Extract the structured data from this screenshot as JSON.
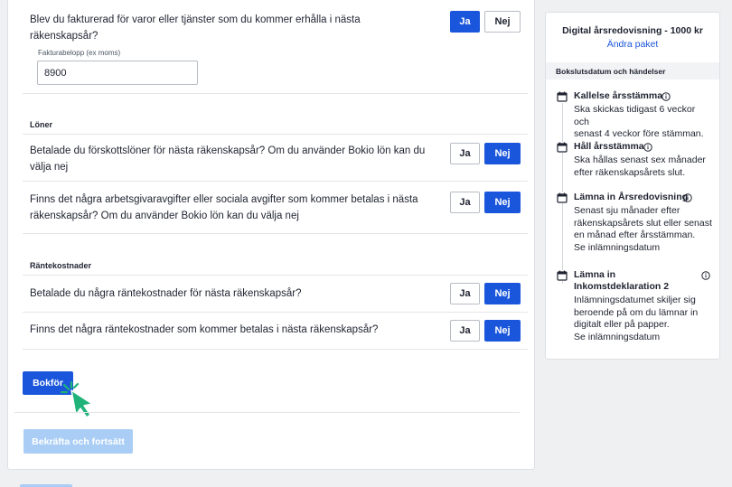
{
  "questions": {
    "invoiced": {
      "text_line1": "Blev du fakturerad för varor eller tjänster som du kommer erhålla i nästa",
      "text_line2": "räkenskapsår?",
      "field_label": "Fakturabelopp (ex moms)",
      "field_value": "8900",
      "yes": "Ja",
      "no": "Nej"
    }
  },
  "salaries": {
    "section_title": "Löner",
    "q1_line1": "Betalade du förskottslöner för nästa räkenskapsår? Om du använder Bokio lön kan du",
    "q1_line2": "välja nej",
    "q2_line1": "Finns det några arbetsgivaravgifter eller sociala avgifter som kommer betalas i nästa",
    "q2_line2": "räkenskapsår? Om du använder Bokio lön kan du välja nej",
    "yes": "Ja",
    "no": "Nej"
  },
  "interest": {
    "section_title": "Räntekostnader",
    "q1": "Betalade du några räntekostnader för nästa räkenskapsår?",
    "q2": "Finns det några räntekostnader som kommer betalas i nästa räkenskapsår?",
    "yes": "Ja",
    "no": "Nej"
  },
  "actions": {
    "bokfor": "Bokför",
    "confirm": "Bekräfta och fortsätt"
  },
  "sidebar": {
    "plan_title": "Digital årsredovisning - 1000 kr",
    "change_plan": "Ändra paket",
    "header": "Bokslutsdatum och händelser",
    "events": [
      {
        "title": "Kallelse årsstämma",
        "lines": [
          "Ska skickas tidigast 6 veckor och",
          "senast 4 veckor före stämman."
        ]
      },
      {
        "title": "Håll årsstämma",
        "lines": [
          "Ska hållas senast sex månader",
          "efter räkenskapsårets slut."
        ]
      },
      {
        "title": "Lämna in Årsredovisning",
        "lines": [
          "Senast sju månader efter",
          "räkenskapsårets slut eller senast",
          "en månad efter årsstämman.",
          "Se inlämningsdatum"
        ]
      },
      {
        "title_line1": "Lämna in",
        "title_line2": "Inkomstdeklaration 2",
        "lines": [
          "Inlämningsdatumet skiljer sig",
          "beroende på om du lämnar in",
          "digitalt eller på papper.",
          "Se inlämningsdatum"
        ]
      }
    ]
  },
  "colors": {
    "primary": "#1a56db",
    "disabled": "#a9cdf5",
    "cursor": "#1fb37a"
  }
}
